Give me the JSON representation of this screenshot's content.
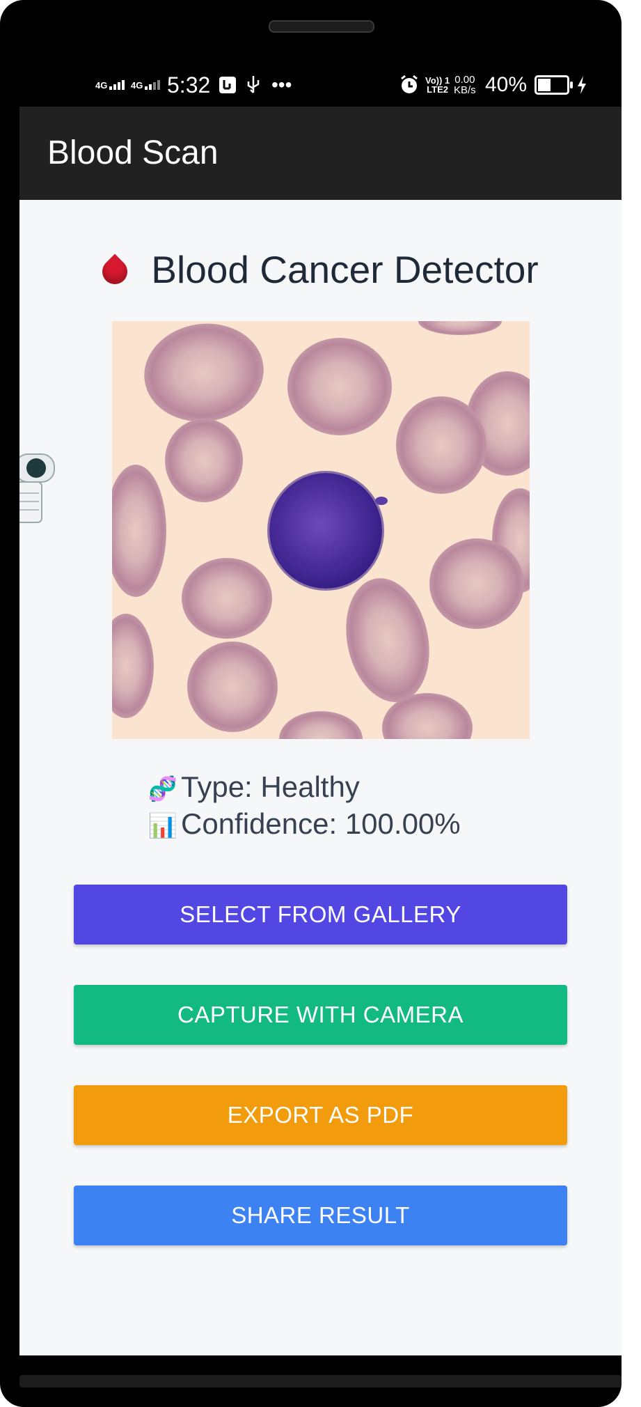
{
  "status_bar": {
    "signal1": "4G",
    "signal2": "4G",
    "time": "5:32",
    "volte_top": "Vo)) 1",
    "volte_bottom": "LTE2",
    "speed_top": "0.00",
    "speed_bottom": "KB/s",
    "battery_percent": "40%",
    "battery_level": 0.4,
    "icons": [
      "usb-debug-icon",
      "usb-icon",
      "more-dots-icon",
      "alarm-icon",
      "charging-icon"
    ]
  },
  "app_bar": {
    "title": "Blood Scan"
  },
  "main": {
    "heading_emoji": "🩸",
    "heading": "Blood Cancer Detector",
    "result": {
      "type_emoji": "🧬",
      "type_text": "Type: Healthy",
      "confidence_emoji": "📊",
      "confidence_text": "Confidence: 100.00%"
    },
    "buttons": [
      {
        "label": "SELECT FROM GALLERY",
        "color": "#5347e3"
      },
      {
        "label": "CAPTURE WITH CAMERA",
        "color": "#12b981"
      },
      {
        "label": "EXPORT AS PDF",
        "color": "#f29c0d"
      },
      {
        "label": "SHARE RESULT",
        "color": "#3d82f3"
      }
    ]
  }
}
